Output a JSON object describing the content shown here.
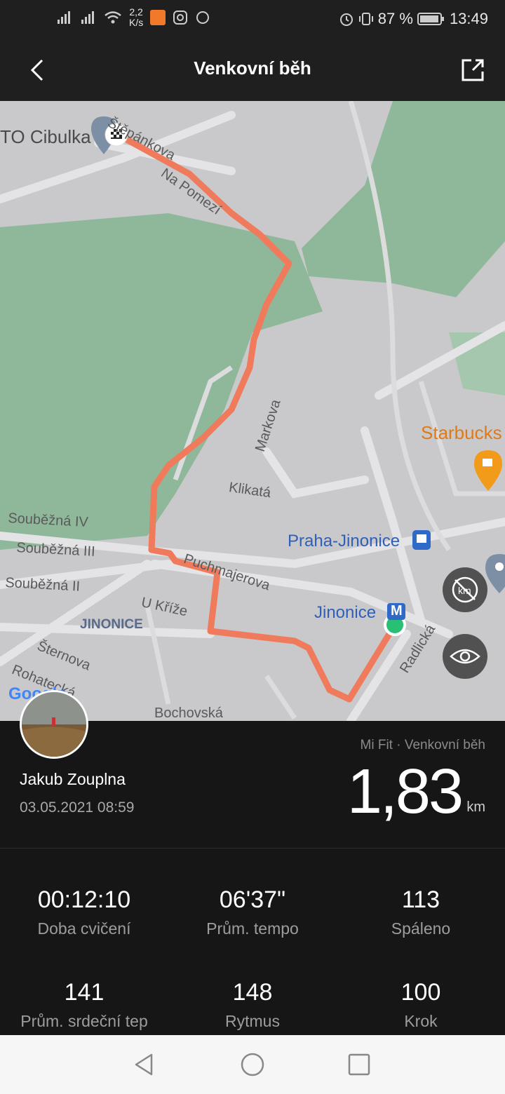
{
  "status_bar": {
    "net_speed_value": "2,2",
    "net_speed_unit": "K/s",
    "battery": "87 %",
    "time": "13:49"
  },
  "header": {
    "title": "Venkovní běh"
  },
  "map": {
    "labels": {
      "cibulka": "TO Cibulka",
      "stepankova": "Štěpánkova",
      "na_pomezi": "Na Pomezí",
      "markova": "Markova",
      "klikata": "Klikatá",
      "soubezna4": "Souběžná IV",
      "soubezna3": "Souběžná III",
      "soubezna2": "Souběžná II",
      "puchmajerova": "Puchmajerova",
      "u_krize": "U Kříže",
      "jinonice_area": "JINONICE",
      "sternova": "Šternova",
      "rohatecka": "Rohatecká",
      "bochovska": "Bochovská",
      "radlicka": "Radlická",
      "praha_jinonice": "Praha-Jinonice",
      "jinonice_metro": "Jinonice",
      "starbucks": "Starbucks",
      "metro_badge": "M",
      "google": "Google"
    },
    "icons": {
      "finish": "checkered-flag-icon",
      "start": "start-dot-icon",
      "train": "train-icon",
      "cafe": "cafe-icon"
    },
    "route_color": "#f07a5c"
  },
  "profile": {
    "name": "Jakub Zouplna",
    "datetime": "03.05.2021 08:59",
    "source": "Mi Fit · Venkovní běh",
    "distance": "1,83",
    "distance_unit": "km"
  },
  "stats": [
    {
      "value": "00:12:10",
      "label": "Doba cvičení"
    },
    {
      "value": "06'37\"",
      "label": "Prům. tempo"
    },
    {
      "value": "113",
      "label": "Spáleno"
    },
    {
      "value": "141",
      "label": "Prům. srdeční tep"
    },
    {
      "value": "148",
      "label": "Rytmus"
    },
    {
      "value": "100",
      "label": "Krok"
    }
  ],
  "nav": {
    "back": "back-triangle-icon",
    "home": "home-circle-icon",
    "recents": "recents-square-icon"
  }
}
